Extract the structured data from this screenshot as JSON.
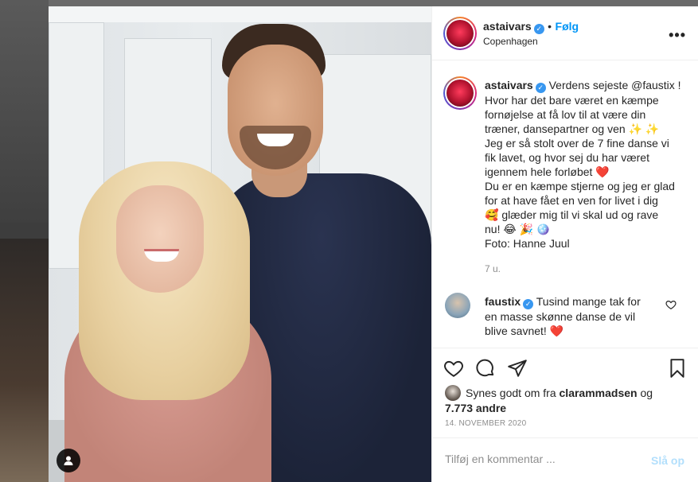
{
  "post": {
    "author": {
      "username": "astaivars",
      "verified_icon": "verified-badge-icon",
      "follow_label": "Følg",
      "location": "Copenhagen"
    },
    "more_icon": "more-options-icon",
    "caption": {
      "username": "astaivars",
      "lines": [
        "Verdens sejeste @faustix !",
        "Hvor har det bare været en kæmpe",
        "fornøjelse at få lov til at være din",
        "træner, dansepartner og ven ✨ ✨",
        "Jeg er så stolt over de 7 fine danse vi",
        "fik lavet, og hvor sej du har været",
        "igennem hele forløbet ❤️",
        "Du er en kæmpe stjerne og jeg er glad",
        "for at have fået en ven for livet i dig",
        "🥰 glæder mig til vi skal ud og rave",
        "nu! 😂 🎉 🪩",
        "Foto: Hanne Juul"
      ],
      "time_ago": "7 u."
    },
    "reply": {
      "username": "faustix",
      "lines": [
        "Tusind mange tak for",
        "en masse skønne danse de vil",
        "blive savnet! ❤️"
      ]
    },
    "actions": {
      "like_icon": "heart-icon",
      "comment_icon": "comment-icon",
      "share_icon": "share-icon",
      "save_icon": "bookmark-icon"
    },
    "likes": {
      "prefix": "Synes godt om fra",
      "liker": "clarammadsen",
      "joiner": "og",
      "count": "7.773 andre"
    },
    "date": "14. NOVEMBER 2020",
    "composer": {
      "placeholder": "Tilføj en kommentar ...",
      "post_label": "Slå op"
    },
    "photo_tag_icon": "user-tag-icon"
  }
}
